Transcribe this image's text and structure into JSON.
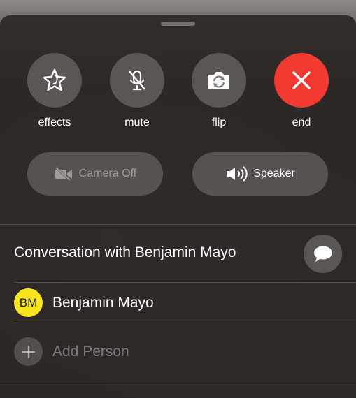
{
  "controls": [
    {
      "label": "effects",
      "icon": "star-effects-icon"
    },
    {
      "label": "mute",
      "icon": "microphone-slash-icon"
    },
    {
      "label": "flip",
      "icon": "camera-flip-icon"
    },
    {
      "label": "end",
      "icon": "close-x-icon"
    }
  ],
  "camera_off": {
    "label": "Camera Off",
    "icon": "video-slash-icon"
  },
  "speaker": {
    "label": "Speaker",
    "icon": "speaker-wave-icon"
  },
  "conversation": {
    "title": "Conversation with Benjamin Mayo",
    "message_icon": "message-bubble-icon"
  },
  "participants": [
    {
      "initials": "BM",
      "name": "Benjamin Mayo"
    }
  ],
  "add_person": {
    "label": "Add Person",
    "icon": "plus-icon"
  },
  "colors": {
    "end_red": "#f23a33",
    "avatar_yellow": "#f8e51e"
  }
}
